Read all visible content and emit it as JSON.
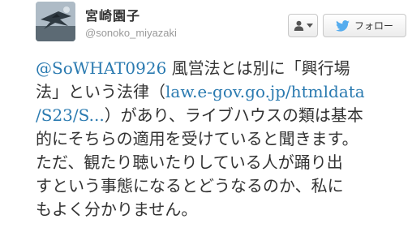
{
  "author": {
    "name": "宮崎園子",
    "handle": "@sonoko_miyazaki"
  },
  "buttons": {
    "user_actions_icon": "person-icon",
    "follow_label": "フォロー",
    "follow_icon": "twitter-bird-icon"
  },
  "tweet": {
    "mention": "@SoWHAT0926",
    "text_1": " 風営法とは別に「興行場",
    "text_2": "法」という法律（",
    "link_1": "law.e-gov.go.jp/htmldata",
    "link_2": "/S23/S...",
    "text_3": "）があり、ライブハウスの類は基本",
    "line_4": "的にそちらの適用を受けていると聞きます。",
    "line_5": "ただ、観たり聴いたりしている人が踊り出",
    "line_6": "すという事態になるとどうなるのか、私に",
    "line_7": "もよく分かりません。"
  },
  "colors": {
    "link": "#2a7ab0",
    "text": "#333333",
    "handle": "#999999",
    "bird": "#55acee"
  }
}
